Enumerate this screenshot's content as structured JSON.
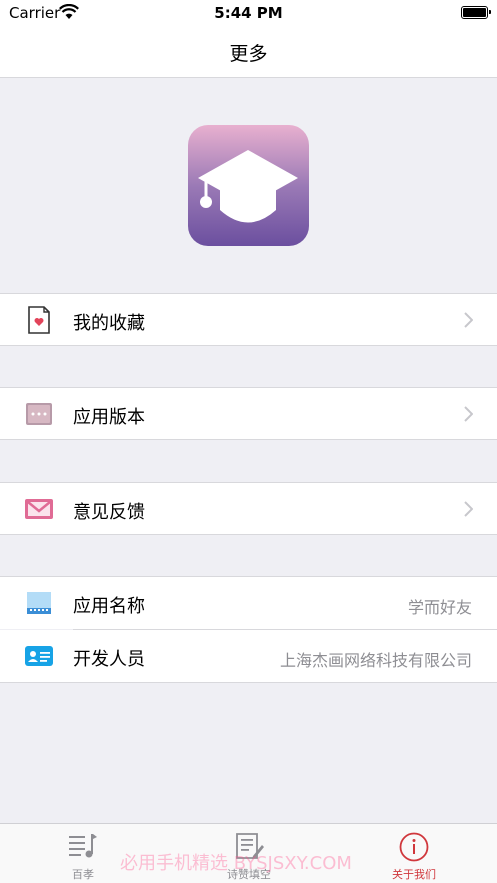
{
  "status_bar": {
    "carrier": "Carrier",
    "time": "5:44 PM"
  },
  "nav": {
    "title": "更多"
  },
  "app_icon": {
    "name": "graduation-cap-icon"
  },
  "menu": {
    "favorites": {
      "label": "我的收藏",
      "icon": "document-heart-icon"
    },
    "version": {
      "label": "应用版本",
      "icon": "version-dots-icon"
    },
    "feedback": {
      "label": "意见反馈",
      "icon": "mail-icon"
    }
  },
  "info": {
    "app_name": {
      "label": "应用名称",
      "value": "学而好友",
      "icon": "app-window-icon"
    },
    "developer": {
      "label": "开发人员",
      "value": "上海杰画网络科技有限公司",
      "icon": "id-card-icon"
    }
  },
  "tabs": [
    {
      "label": "百孝",
      "icon": "music-list-icon"
    },
    {
      "label": "诗赞填空",
      "icon": "edit-note-icon"
    },
    {
      "label": "关于我们",
      "icon": "info-circle-icon",
      "active": true
    }
  ],
  "watermark": "必用手机精选 BYSJSXY.COM",
  "colors": {
    "accent": "#d0373c",
    "background": "#efeff4",
    "secondary_text": "#8e8e93"
  }
}
